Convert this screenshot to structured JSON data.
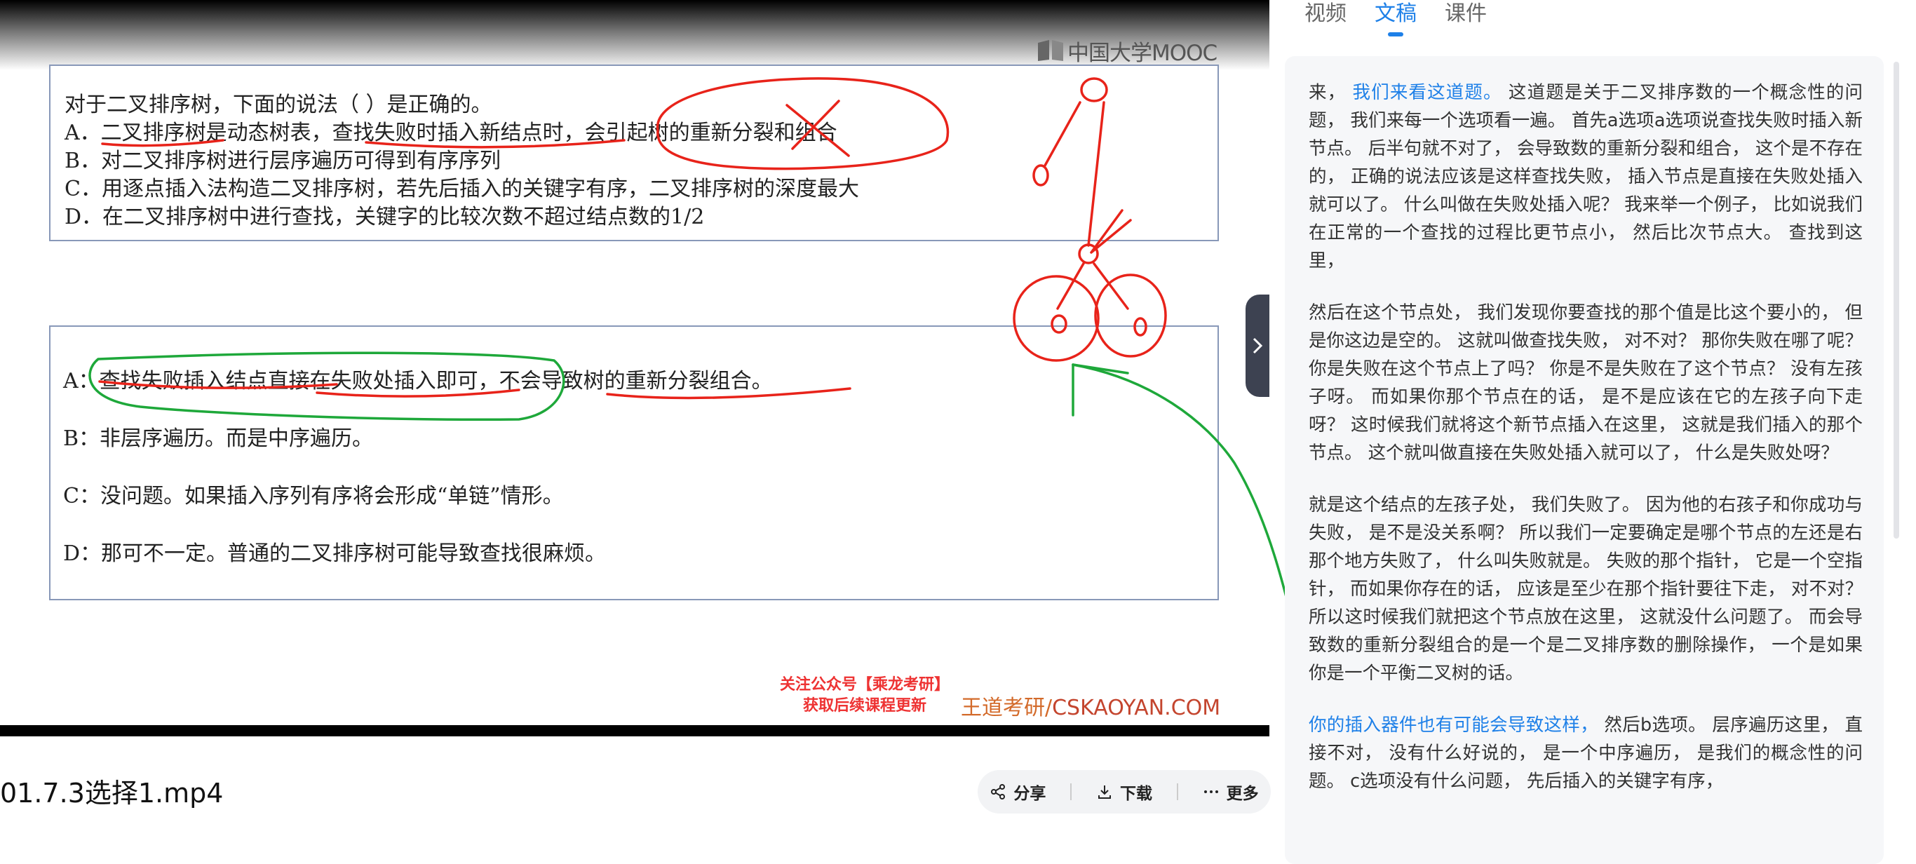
{
  "video": {
    "logo_text": "中国大学MOOC",
    "question": {
      "stem": "对于二叉排序树，下面的说法（        ）是正确的。",
      "options": [
        "A．二叉排序树是动态树表，查找失败时插入新结点时，会引起树的重新分裂和组合",
        "B．对二叉排序树进行层序遍历可得到有序序列",
        "C．用逐点插入法构造二叉排序树，若先后插入的关键字有序，二叉排序树的深度最大",
        "D．在二叉排序树中进行查找，关键字的比较次数不超过结点数的1/2"
      ]
    },
    "answers": [
      "A：查找失败插入结点直接在失败处插入即可，不会导致树的重新分裂组合。",
      "B：非层序遍历。而是中序遍历。",
      "C：没问题。如果插入序列有序将会形成“单链”情形。",
      "D：那可不一定。普通的二叉排序树可能导致查找很麻烦。"
    ],
    "wechat_line1": "关注公众号【乘龙考研】",
    "wechat_line2": "获取后续课程更新",
    "brand_cn": "王道考研/",
    "brand_en": "CSKAOYAN.COM"
  },
  "file_title": "01.7.3选择1.mp4",
  "actions": {
    "share": "分享",
    "download": "下载",
    "more": "更多"
  },
  "tabs": [
    "视频",
    "文稿",
    "课件"
  ],
  "active_tab": "文稿",
  "transcript": [
    {
      "highlight": "我们来看这道题。",
      "lead": "来， ",
      "text": " 这道题是关于二叉排序数的一个概念性的问题， 我们来每一个选项看一遍。 首先a选项a选项说查找失败时插入新节点。 后半句就不对了， 会导致数的重新分裂和组合， 这个是不存在的， 正确的说法应该是这样查找失败， 插入节点是直接在失败处插入就可以了。 什么叫做在失败处插入呢？ 我来举一个例子， 比如说我们在正常的一个查找的过程比更节点小， 然后比次节点大。 查找到这里，"
    },
    {
      "lead": "",
      "highlight": "",
      "text": "然后在这个节点处， 我们发现你要查找的那个值是比这个要小的， 但是你这边是空的。 这就叫做查找失败， 对不对？ 那你失败在哪了呢？ 你是失败在这个节点上了吗？ 你是不是失败在了这个节点？ 没有左孩子呀。 而如果你那个节点在的话， 是不是应该在它的左孩子向下走呀？ 这时候我们就将这个新节点插入在这里， 这就是我们插入的那个节点。 这个就叫做直接在失败处插入就可以了， 什么是失败处呀？"
    },
    {
      "lead": "",
      "highlight": "",
      "text": "就是这个结点的左孩子处， 我们失败了。 因为他的右孩子和你成功与失败， 是不是没关系啊？ 所以我们一定要确定是哪个节点的左还是右那个地方失败了， 什么叫失败就是。 失败的那个指针， 它是一个空指针， 而如果你存在的话， 应该是至少在那个指针要往下走， 对不对？ 所以这时候我们就把这个节点放在这里， 这就没什么问题了。 而会导致数的重新分裂组合的是一个是二叉排序数的删除操作， 一个是如果你是一个平衡二叉树的话。"
    },
    {
      "lead": "",
      "highlight": "你的插入器件也有可能会导致这样，",
      "text": " 然后b选项。 层序遍历这里， 直接不对， 没有什么好说的， 是一个中序遍历， 是我们的概念性的问题。 c选项没有什么问题， 先后插入的关键字有序，"
    }
  ],
  "colors": {
    "accent": "#1e80e8",
    "annotation_red": "#e8231a",
    "annotation_green": "#1ea83a"
  }
}
